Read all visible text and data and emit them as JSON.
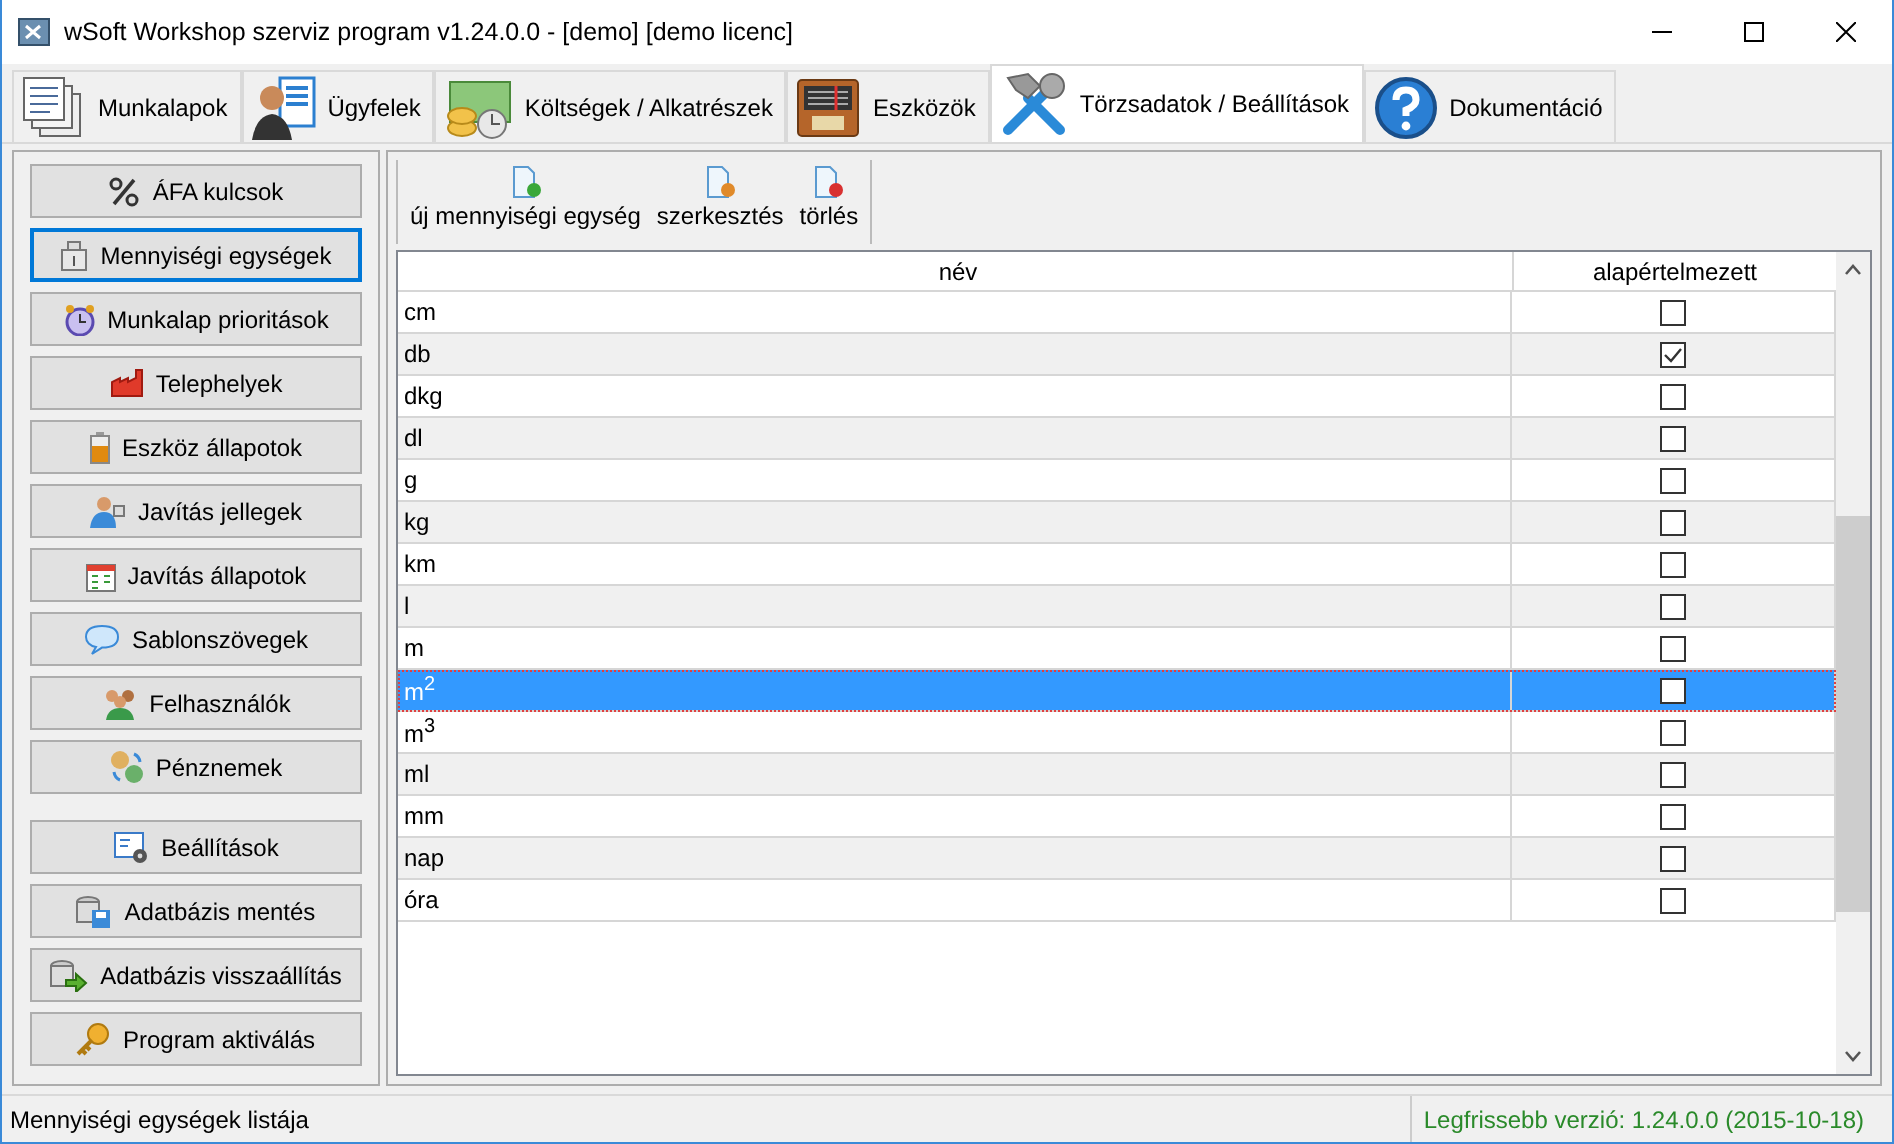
{
  "window": {
    "title": "wSoft Workshop szerviz program v1.24.0.0 - [demo] [demo licenc]"
  },
  "tabs": [
    {
      "label": "Munkalapok",
      "selected": false
    },
    {
      "label": "Ügyfelek",
      "selected": false
    },
    {
      "label": "Költségek / Alkatrészek",
      "selected": false
    },
    {
      "label": "Eszközök",
      "selected": false
    },
    {
      "label": "Törzsadatok / Beállítások",
      "selected": true
    },
    {
      "label": "Dokumentáció",
      "selected": false
    }
  ],
  "sidebar": {
    "groups": [
      [
        {
          "label": "ÁFA kulcsok",
          "selected": false
        },
        {
          "label": "Mennyiségi egységek",
          "selected": true
        },
        {
          "label": "Munkalap prioritások",
          "selected": false
        },
        {
          "label": "Telephelyek",
          "selected": false
        },
        {
          "label": "Eszköz állapotok",
          "selected": false
        },
        {
          "label": "Javítás jellegek",
          "selected": false
        },
        {
          "label": "Javítás állapotok",
          "selected": false
        },
        {
          "label": "Sablonszövegek",
          "selected": false
        },
        {
          "label": "Felhasználók",
          "selected": false
        },
        {
          "label": "Pénznemek",
          "selected": false
        }
      ],
      [
        {
          "label": "Beállítások",
          "selected": false
        },
        {
          "label": "Adatbázis mentés",
          "selected": false
        },
        {
          "label": "Adatbázis visszaállítás",
          "selected": false
        },
        {
          "label": "Program aktiválás",
          "selected": false
        }
      ]
    ]
  },
  "toolbar": [
    {
      "label": "új mennyiségi egység",
      "kind": "add"
    },
    {
      "label": "szerkesztés",
      "kind": "edit"
    },
    {
      "label": "törlés",
      "kind": "delete"
    }
  ],
  "table": {
    "columns": [
      "név",
      "alapértelmezett"
    ],
    "rows": [
      {
        "name": "cm",
        "default": false,
        "selected": false
      },
      {
        "name": "db",
        "default": true,
        "selected": false
      },
      {
        "name": "dkg",
        "default": false,
        "selected": false
      },
      {
        "name": "dl",
        "default": false,
        "selected": false
      },
      {
        "name": "g",
        "default": false,
        "selected": false
      },
      {
        "name": "kg",
        "default": false,
        "selected": false
      },
      {
        "name": "km",
        "default": false,
        "selected": false
      },
      {
        "name": "l",
        "default": false,
        "selected": false
      },
      {
        "name": "m",
        "default": false,
        "selected": false
      },
      {
        "name": "m$^{2}$",
        "default": false,
        "selected": true
      },
      {
        "name": "m$^{3}$",
        "default": false,
        "selected": false
      },
      {
        "name": "ml",
        "default": false,
        "selected": false
      },
      {
        "name": "mm",
        "default": false,
        "selected": false
      },
      {
        "name": "nap",
        "default": false,
        "selected": false
      },
      {
        "name": "óra",
        "default": false,
        "selected": false
      }
    ]
  },
  "status_bar": {
    "message": "Mennyiségi egységek listája",
    "version": "Legfrissebb verzió: 1.24.0.0 (2015-10-18)"
  }
}
